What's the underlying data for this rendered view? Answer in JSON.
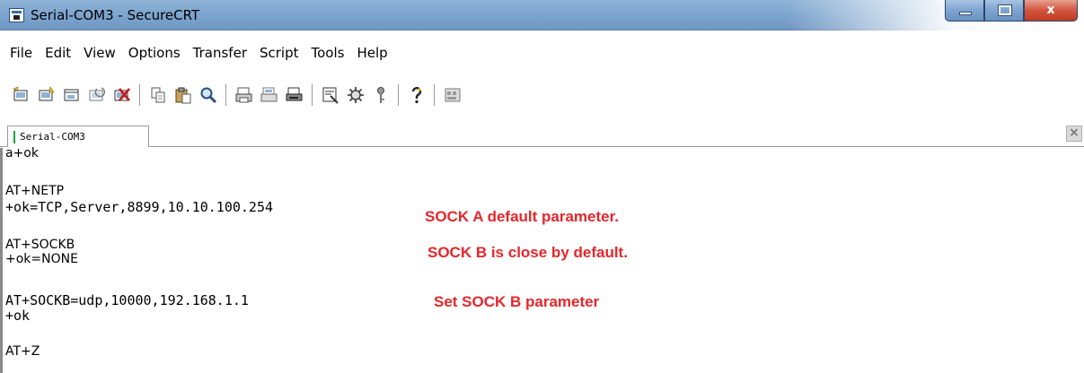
{
  "window": {
    "title": "Serial-COM3 - SecureCRT",
    "controls": {
      "minimize": "minimize",
      "maximize": "maximize",
      "close": "x"
    }
  },
  "menu": [
    "File",
    "Edit",
    "View",
    "Options",
    "Transfer",
    "Script",
    "Tools",
    "Help"
  ],
  "toolbar": {
    "icons": [
      "connect-icon",
      "quick-connect-icon",
      "connect-in-tab-icon",
      "reconnect-icon",
      "disconnect-icon",
      "copy-icon",
      "paste-icon",
      "find-icon",
      "print-icon",
      "print-selection-icon",
      "print-setup-icon",
      "session-options-icon",
      "global-options-icon",
      "key-icon",
      "help-icon",
      "keymap-icon"
    ]
  },
  "tabs": [
    {
      "label": "Serial-COM3",
      "active": true
    }
  ],
  "tab_close": "×",
  "terminal": {
    "lines": [
      {
        "text": "a+ok",
        "font": "sans"
      },
      {
        "text": "",
        "font": "sans"
      },
      {
        "text": "AT+NETP",
        "font": "sans"
      },
      {
        "text": "+ok=TCP,Server,8899,10.10.100.254",
        "font": "mono"
      },
      {
        "text": "",
        "font": "sans"
      },
      {
        "text": "AT+SOCKB",
        "font": "sans"
      },
      {
        "text": "+ok=NONE",
        "font": "sans"
      },
      {
        "text": "",
        "font": "sans"
      },
      {
        "text": "AT+SOCKB=udp,10000,192.168.1.1",
        "font": "mono"
      },
      {
        "text": "+ok",
        "font": "mono"
      },
      {
        "text": "",
        "font": "sans"
      },
      {
        "text": "AT+Z",
        "font": "sans"
      }
    ],
    "annotations": [
      "SOCK A default parameter.",
      "SOCK B is close by default.",
      "Set SOCK B parameter"
    ],
    "annotation_color": "#e5262b"
  }
}
